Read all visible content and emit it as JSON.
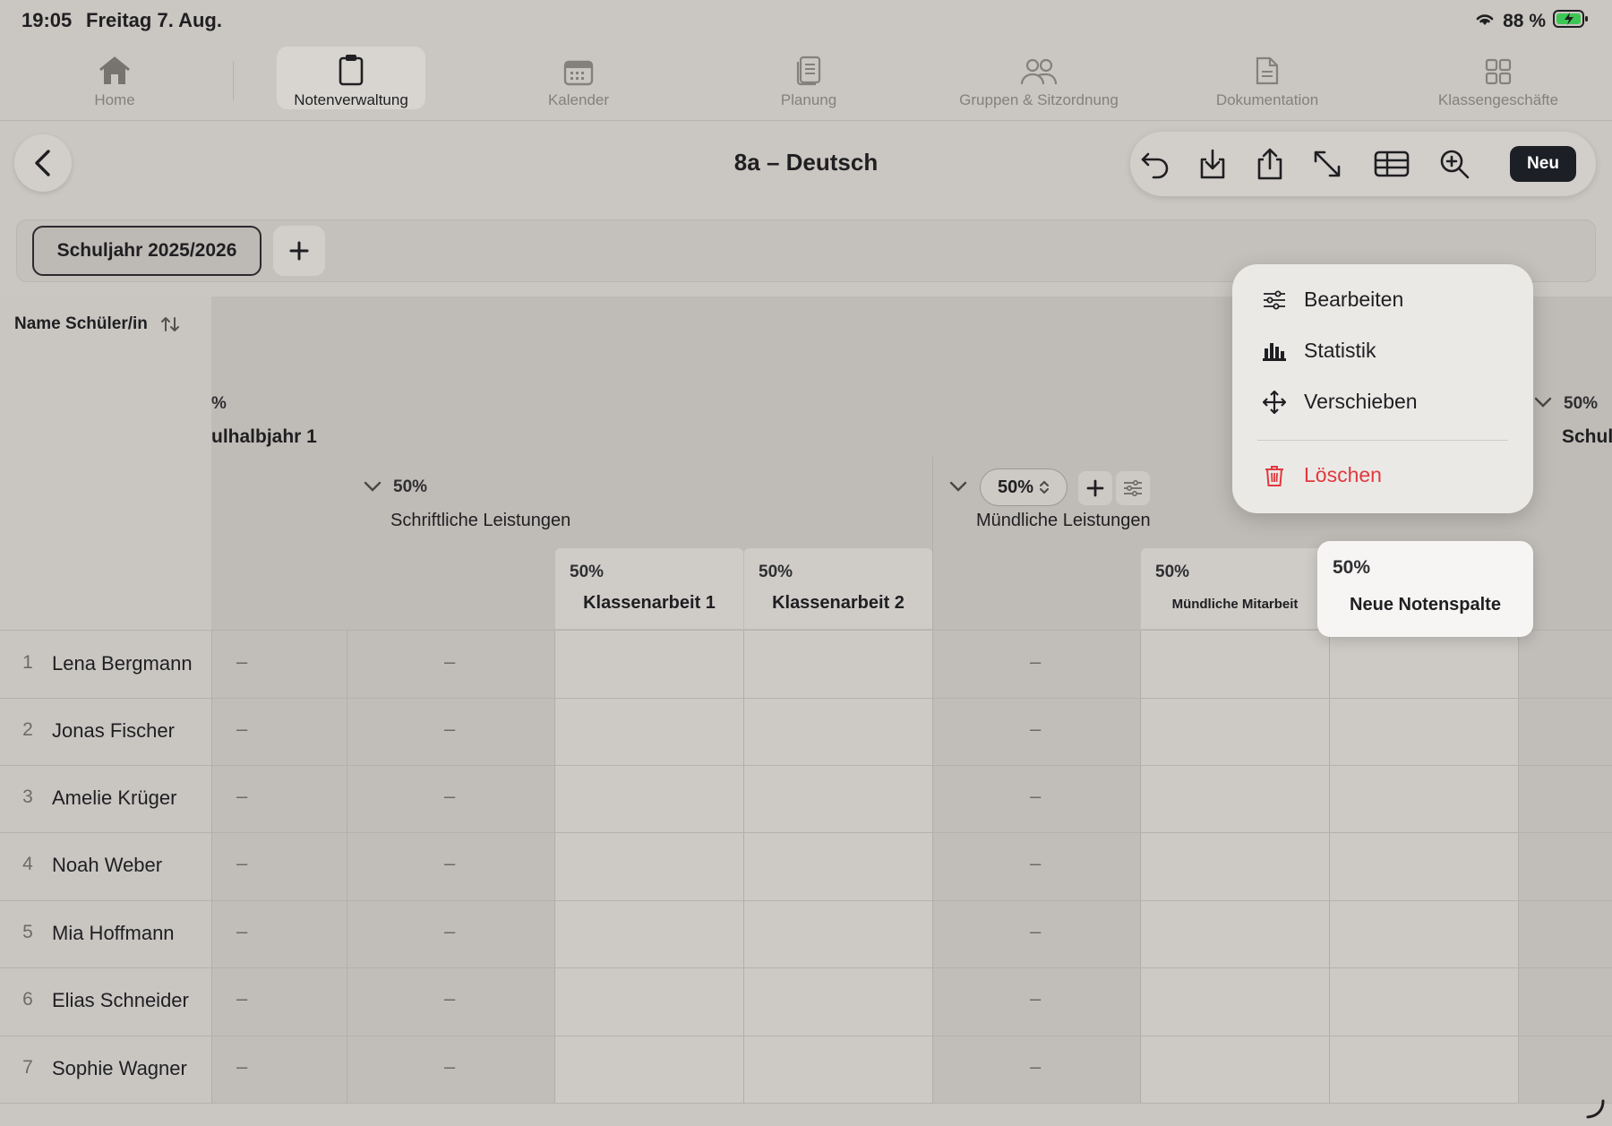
{
  "status": {
    "time": "19:05",
    "date": "Freitag 7. Aug.",
    "battery": "88 %"
  },
  "tabs": [
    {
      "label": "Home",
      "icon": "home-icon"
    },
    {
      "label": "Notenverwaltung",
      "icon": "clipboard-icon",
      "active": true
    },
    {
      "label": "Kalender",
      "icon": "calendar-icon"
    },
    {
      "label": "Planung",
      "icon": "document-stack-icon"
    },
    {
      "label": "Gruppen & Sitzordnung",
      "icon": "people-icon"
    },
    {
      "label": "Dokumentation",
      "icon": "document-icon"
    },
    {
      "label": "Klassengeschäfte",
      "icon": "grid-icon"
    }
  ],
  "header": {
    "title": "8a – Deutsch",
    "new_label": "Neu"
  },
  "year": {
    "label": "Schuljahr 2025/2026"
  },
  "table": {
    "sort_label": "Name Schüler/in",
    "half_left": {
      "pct": "%",
      "title": "ulhalbjahr 1"
    },
    "half_right": {
      "pct": "50%",
      "title": "Schul"
    },
    "written": {
      "pct": "50%",
      "title": "Schriftliche Leistungen"
    },
    "oral": {
      "pct": "50%",
      "title": "Mündliche Leistungen"
    },
    "columns": [
      {
        "pct": "50%",
        "title": "Klassenarbeit 1"
      },
      {
        "pct": "50%",
        "title": "Klassenarbeit 2"
      },
      {
        "pct": "50%",
        "title": "Mündliche Mitarbeit"
      },
      {
        "pct": "50%",
        "title": "Neue Notenspalte"
      }
    ],
    "dash": "–",
    "students": [
      {
        "n": "1",
        "name": "Lena Bergmann"
      },
      {
        "n": "2",
        "name": "Jonas Fischer"
      },
      {
        "n": "3",
        "name": "Amelie Krüger"
      },
      {
        "n": "4",
        "name": "Noah Weber"
      },
      {
        "n": "5",
        "name": "Mia Hoffmann"
      },
      {
        "n": "6",
        "name": "Elias Schneider"
      },
      {
        "n": "7",
        "name": "Sophie Wagner"
      }
    ]
  },
  "menu": {
    "edit": "Bearbeiten",
    "stats": "Statistik",
    "move": "Verschieben",
    "delete": "Löschen"
  },
  "colors": {
    "accent_dark": "#1d1f26",
    "danger": "#e0393e",
    "background": "#cac6c1"
  }
}
